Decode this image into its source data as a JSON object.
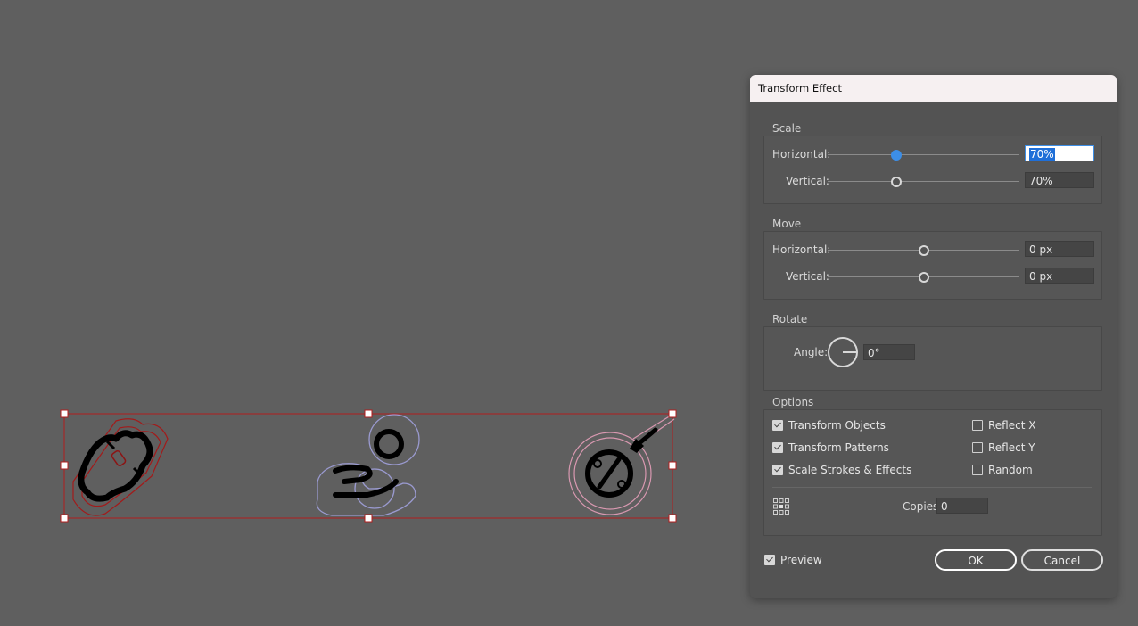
{
  "dialog": {
    "title": "Transform Effect",
    "scale": {
      "label": "Scale",
      "horizontal_label": "Horizontal:",
      "horizontal_value": "70%",
      "vertical_label": "Vertical:",
      "vertical_value": "70%"
    },
    "move": {
      "label": "Move",
      "horizontal_label": "Horizontal:",
      "horizontal_value": "0 px",
      "vertical_label": "Vertical:",
      "vertical_value": "0 px"
    },
    "rotate": {
      "label": "Rotate",
      "angle_label": "Angle:",
      "angle_value": "0°"
    },
    "options": {
      "label": "Options",
      "transform_objects": "Transform Objects",
      "transform_patterns": "Transform Patterns",
      "scale_strokes": "Scale Strokes & Effects",
      "reflect_x": "Reflect X",
      "reflect_y": "Reflect Y",
      "random": "Random",
      "copies_label": "Copies",
      "copies_value": "0"
    },
    "preview_label": "Preview",
    "ok_label": "OK",
    "cancel_label": "Cancel"
  },
  "colors": {
    "canvas_bg": "#5f5f5f",
    "dialog_bg": "#535353",
    "selection_red": "#b01c1c",
    "accent_blue": "#3d8ee6"
  },
  "icons": [
    "tag-icon",
    "hand-coin-icon",
    "discount-tag-icon",
    "reference-point-icon",
    "angle-dial-icon"
  ]
}
